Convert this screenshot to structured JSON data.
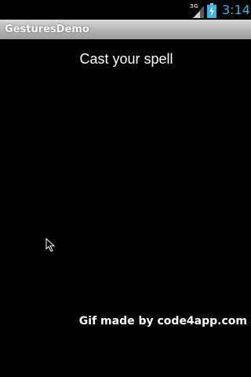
{
  "status_bar": {
    "network_type": "3G",
    "time": "3:14",
    "icons": [
      "signal-icon",
      "battery-charging-icon"
    ],
    "clock_color": "#33b5e5"
  },
  "title_bar": {
    "title": "GesturesDemo"
  },
  "main": {
    "heading": "Cast your spell",
    "cursor_icon": "mouse-pointer-icon"
  },
  "watermark": {
    "text": "Gif made by code4app.com"
  }
}
